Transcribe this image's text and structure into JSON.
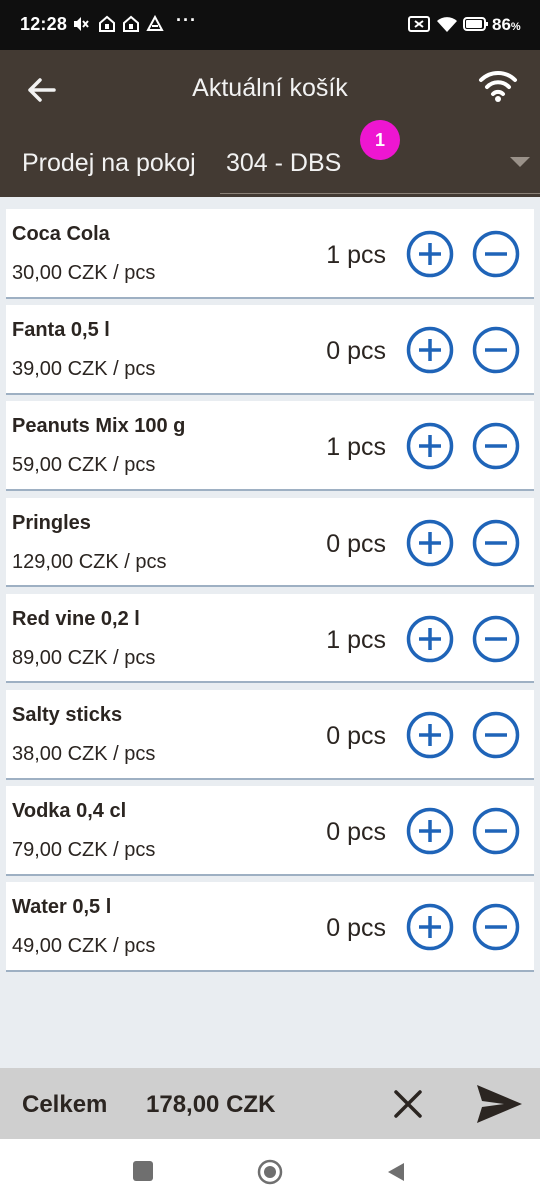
{
  "status_bar": {
    "time": "12:28",
    "dots": "···",
    "battery": "86",
    "battery_unit": "%"
  },
  "app_bar": {
    "title": "Aktuální košík",
    "sale_label": "Prodej na pokoj",
    "room": "304 - DBS",
    "badge": "1"
  },
  "items": [
    {
      "name": "Coca Cola",
      "price": "30,00 CZK / pcs",
      "qty": "1 pcs"
    },
    {
      "name": "Fanta 0,5 l",
      "price": "39,00 CZK / pcs",
      "qty": "0 pcs"
    },
    {
      "name": "Peanuts Mix 100 g",
      "price": "59,00 CZK / pcs",
      "qty": "1 pcs"
    },
    {
      "name": "Pringles",
      "price": "129,00 CZK / pcs",
      "qty": "0 pcs"
    },
    {
      "name": "Red vine 0,2 l",
      "price": "89,00 CZK / pcs",
      "qty": "1 pcs"
    },
    {
      "name": "Salty sticks",
      "price": "38,00 CZK / pcs",
      "qty": "0 pcs"
    },
    {
      "name": "Vodka 0,4 cl",
      "price": "79,00 CZK / pcs",
      "qty": "0 pcs"
    },
    {
      "name": "Water 0,5 l",
      "price": "49,00 CZK / pcs",
      "qty": "0 pcs"
    }
  ],
  "footer": {
    "total_label": "Celkem",
    "total_value": "178,00 CZK"
  },
  "colors": {
    "app_bar": "#433a33",
    "accent_blue": "#1f64b8",
    "badge": "#ee16d1",
    "footer": "#cfcfcf",
    "background": "#e9edf1"
  }
}
